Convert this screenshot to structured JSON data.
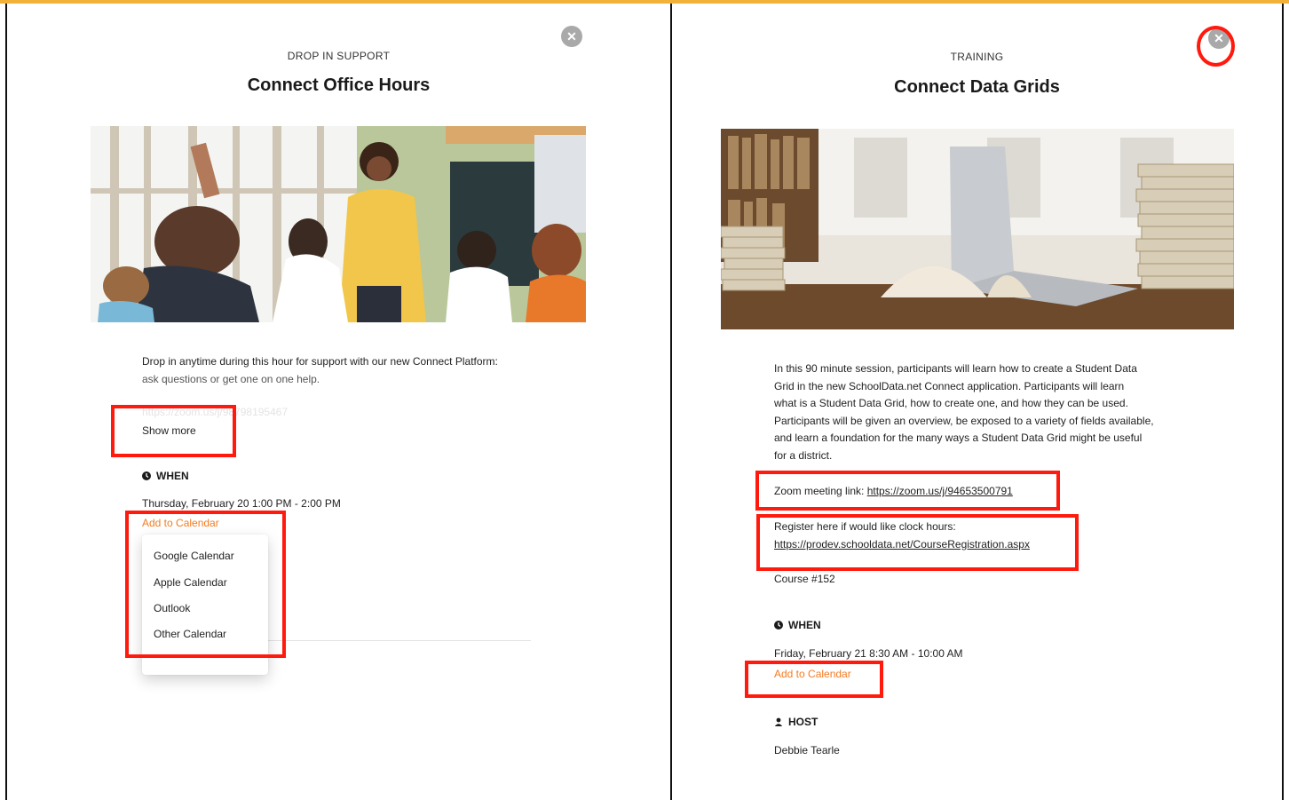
{
  "colors": {
    "accent_orange": "#f47b20",
    "annotation_red": "#ff1a0d",
    "top_bar": "#f2b23a"
  },
  "left": {
    "eyebrow": "DROP IN SUPPORT",
    "title": "Connect Office Hours",
    "close_icon": "close-icon",
    "image_icon": "classroom-photo",
    "description_line1": "Drop in anytime during this hour for support with our new Connect Platform:",
    "description_line2": "ask questions or get one on one help.",
    "faded_link": "https://zoom.us/j/98798195467",
    "show_more": "Show more",
    "when_label": "WHEN",
    "when_value": "Thursday, February 20 1:00 PM - 2:00 PM",
    "add_to_calendar": "Add to Calendar",
    "calendar_options": [
      "Google Calendar",
      "Apple Calendar",
      "Outlook",
      "Other Calendar"
    ]
  },
  "right": {
    "eyebrow": "TRAINING",
    "title": "Connect Data Grids",
    "close_icon": "close-icon",
    "image_icon": "library-laptop-photo",
    "description": [
      "In this 90 minute session, participants will learn how to create a Student Data",
      "Grid in the new SchoolData.net Connect application. Participants will learn",
      "what is a Student Data Grid, how to create one, and how they can be used.",
      "Participants will be given an overview, be exposed to a variety of fields available,",
      "and learn a foundation for the many ways a Student Data Grid might be useful",
      "for a district."
    ],
    "zoom_label": "Zoom meeting link: ",
    "zoom_link": "https://zoom.us/j/94653500791",
    "register_label": "Register here if would like clock hours:",
    "register_link": "https://prodev.schooldata.net/CourseRegistration.aspx",
    "course": "Course #152",
    "when_label": "WHEN",
    "when_value": "Friday, February 21 8:30 AM - 10:00 AM",
    "add_to_calendar": "Add to Calendar",
    "host_label": "HOST",
    "host_value": "Debbie Tearle"
  }
}
